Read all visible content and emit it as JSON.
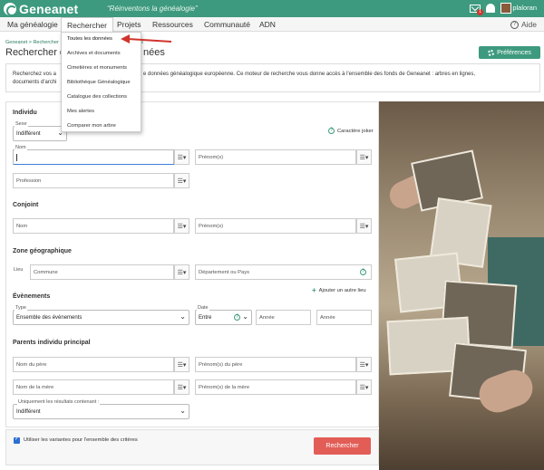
{
  "header": {
    "logo_text": "Geneanet",
    "tagline": "“Réinventons la généalogie”",
    "badge_count": "1",
    "username": "plaloran"
  },
  "nav": {
    "items": [
      "Ma généalogie",
      "Rechercher",
      "Projets",
      "Ressources",
      "Communauté",
      "ADN"
    ],
    "active": "Rechercher",
    "help": "Aide"
  },
  "dropdown": {
    "items": [
      "Toutes les données",
      "Archives et documents",
      "Cimetières et monuments",
      "Bibliothèque Généalogique",
      "Catalogue des collections",
      "Mes alertes",
      "Comparer mon arbre"
    ],
    "selected": "Toutes les données"
  },
  "page": {
    "breadcrumb_home": "Geneanet",
    "breadcrumb_sep": ">",
    "breadcrumb_current": "Rechercher",
    "breadcrumb_tail": "nées",
    "title_start": "Rechercher d",
    "title_end": "nées",
    "preferences": "Préférences",
    "intro_line1_a": "Recherchez vos a",
    "intro_line1_b": "e données généalogique européenne. Ce moteur de recherche vous donne accès à l'ensemble des fonds de Geneanet : arbres en lignes,",
    "intro_line2": "documents d'archi"
  },
  "form": {
    "individu": "Individu",
    "sexe_label": "Sexe",
    "sexe_value": "Indifférent",
    "joker": "Caractère joker",
    "nom_label": "Nom",
    "prenoms_placeholder": "Prénom(s)",
    "profession_placeholder": "Profession",
    "conjoint": "Conjoint",
    "conjoint_nom": "Nom",
    "conjoint_prenom": "Prénom(s)",
    "zone": "Zone géographique",
    "lieu": "Lieu",
    "commune": "Commune",
    "departement": "Département ou Pays",
    "add_place": "Ajouter un autre lieu",
    "evenements": "Évènements",
    "type_label": "Type",
    "type_value": "Ensemble des évènements",
    "date_label": "Date",
    "date_value": "Entre",
    "annee1": "Année",
    "annee2": "Année",
    "parents": "Parents individu principal",
    "nom_pere": "Nom du père",
    "prenom_pere": "Prénom(s) du père",
    "nom_mere": "Nom de la mère",
    "prenom_mere": "Prénom(s) de la mère",
    "only_results_label": "Uniquement les résultats contenant :",
    "only_results_value": "Indifférent",
    "variants": "Utiliser les variantes pour l'ensemble des critères",
    "search_button": "Rechercher"
  },
  "colors": {
    "brand_green": "#3d9a7e",
    "search_red": "#e35d57",
    "arrow_red": "#d0342c"
  }
}
